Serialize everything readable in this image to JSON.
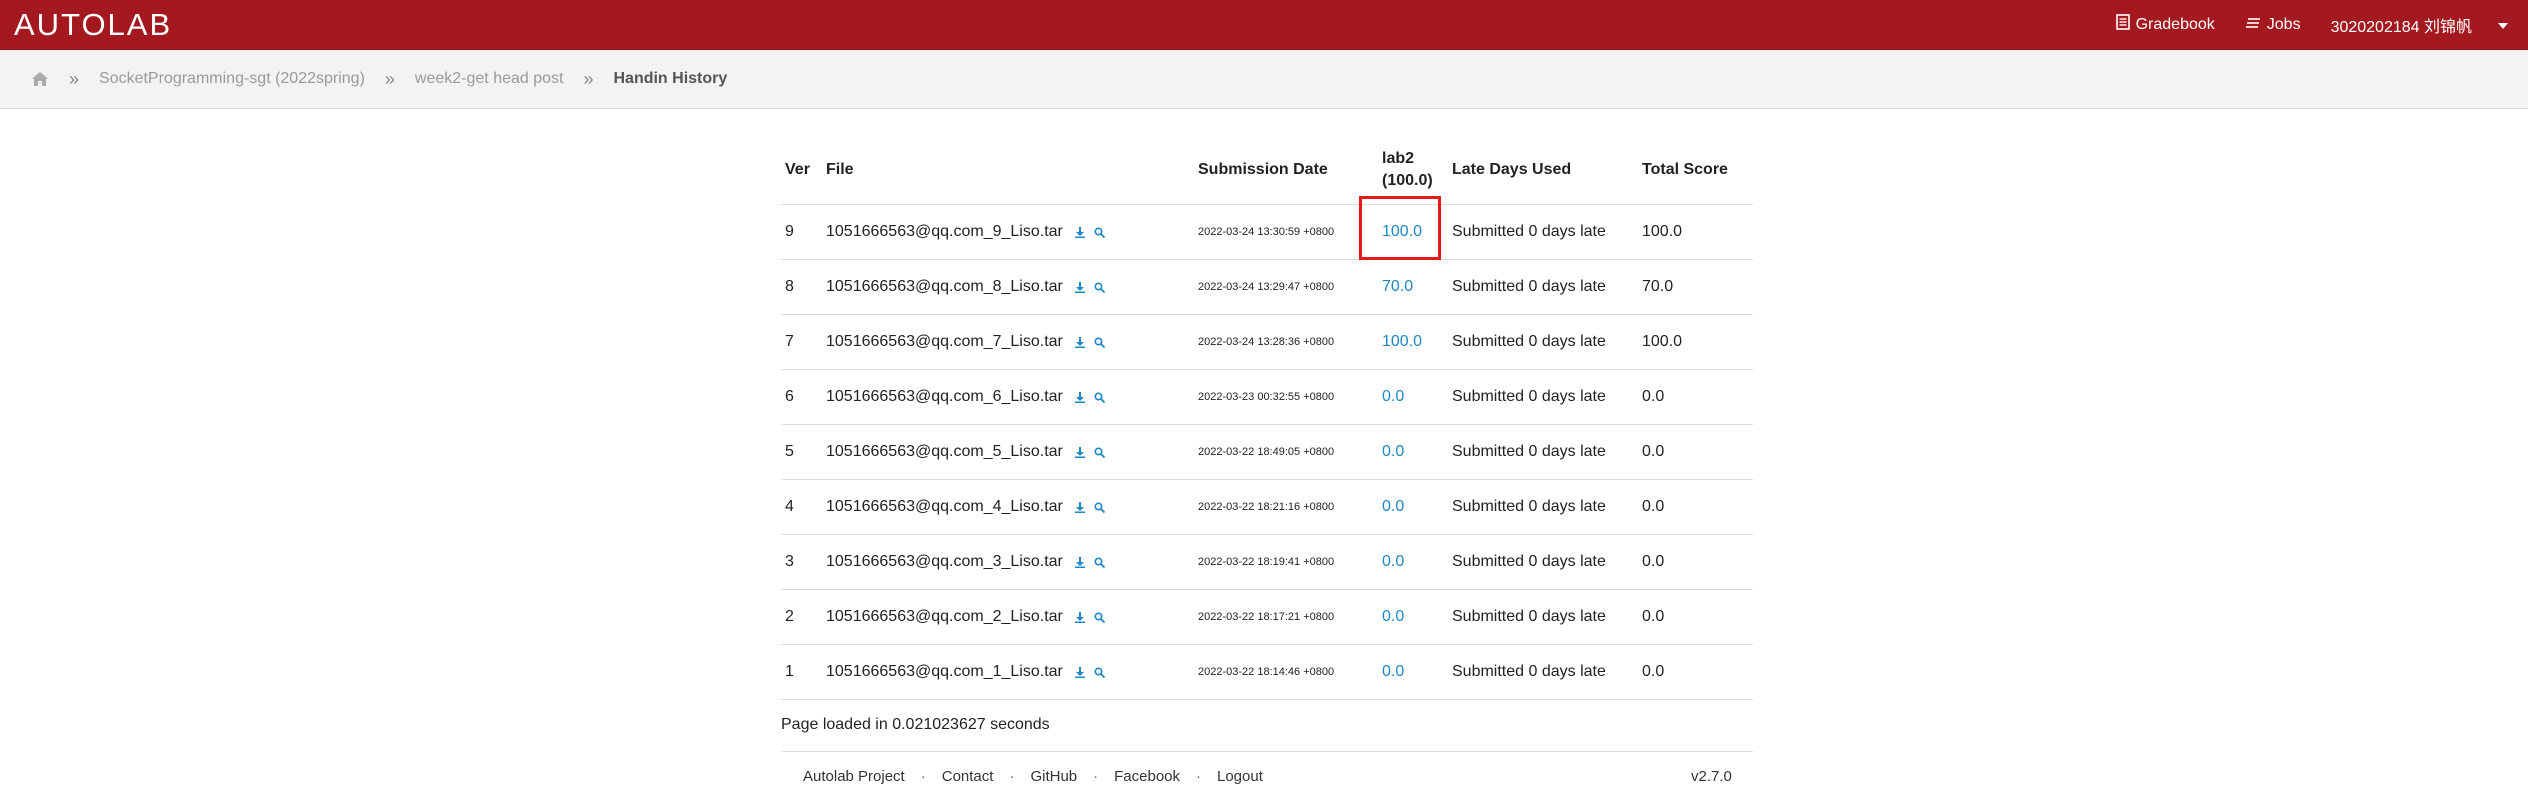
{
  "navbar": {
    "brand": "AUTOLAB",
    "gradebook": "Gradebook",
    "jobs": "Jobs",
    "user": "3020202184 刘锦帆"
  },
  "breadcrumb": {
    "course": "SocketProgramming-sgt (2022spring)",
    "assessment": "week2-get head post",
    "current": "Handin History"
  },
  "table": {
    "headers": {
      "ver": "Ver",
      "file": "File",
      "date": "Submission Date",
      "lab_line1": "lab2",
      "lab_line2": "(100.0)",
      "late": "Late Days Used",
      "total": "Total Score"
    },
    "rows": [
      {
        "ver": "9",
        "file": "1051666563@qq.com_9_Liso.tar",
        "date": "2022-03-24 13:30:59 +0800",
        "score": "100.0",
        "late": "Submitted 0 days late",
        "total": "100.0"
      },
      {
        "ver": "8",
        "file": "1051666563@qq.com_8_Liso.tar",
        "date": "2022-03-24 13:29:47 +0800",
        "score": "70.0",
        "late": "Submitted 0 days late",
        "total": "70.0"
      },
      {
        "ver": "7",
        "file": "1051666563@qq.com_7_Liso.tar",
        "date": "2022-03-24 13:28:36 +0800",
        "score": "100.0",
        "late": "Submitted 0 days late",
        "total": "100.0"
      },
      {
        "ver": "6",
        "file": "1051666563@qq.com_6_Liso.tar",
        "date": "2022-03-23 00:32:55 +0800",
        "score": "0.0",
        "late": "Submitted 0 days late",
        "total": "0.0"
      },
      {
        "ver": "5",
        "file": "1051666563@qq.com_5_Liso.tar",
        "date": "2022-03-22 18:49:05 +0800",
        "score": "0.0",
        "late": "Submitted 0 days late",
        "total": "0.0"
      },
      {
        "ver": "4",
        "file": "1051666563@qq.com_4_Liso.tar",
        "date": "2022-03-22 18:21:16 +0800",
        "score": "0.0",
        "late": "Submitted 0 days late",
        "total": "0.0"
      },
      {
        "ver": "3",
        "file": "1051666563@qq.com_3_Liso.tar",
        "date": "2022-03-22 18:19:41 +0800",
        "score": "0.0",
        "late": "Submitted 0 days late",
        "total": "0.0"
      },
      {
        "ver": "2",
        "file": "1051666563@qq.com_2_Liso.tar",
        "date": "2022-03-22 18:17:21 +0800",
        "score": "0.0",
        "late": "Submitted 0 days late",
        "total": "0.0"
      },
      {
        "ver": "1",
        "file": "1051666563@qq.com_1_Liso.tar",
        "date": "2022-03-22 18:14:46 +0800",
        "score": "0.0",
        "late": "Submitted 0 days late",
        "total": "0.0"
      }
    ]
  },
  "page_loaded": "Page loaded in 0.021023627 seconds",
  "footer": {
    "project": "Autolab Project",
    "contact": "Contact",
    "github": "GitHub",
    "facebook": "Facebook",
    "logout": "Logout",
    "version": "v2.7.0"
  },
  "icons": {
    "home": "home-icon",
    "gradebook": "gradebook-icon",
    "jobs": "jobs-icon",
    "download": "download-icon",
    "view": "magnifier-icon",
    "caret": "caret-down-icon"
  },
  "colors": {
    "navbar": "#a3191f",
    "link": "#1e88c7",
    "highlight": "#e31b1b"
  }
}
